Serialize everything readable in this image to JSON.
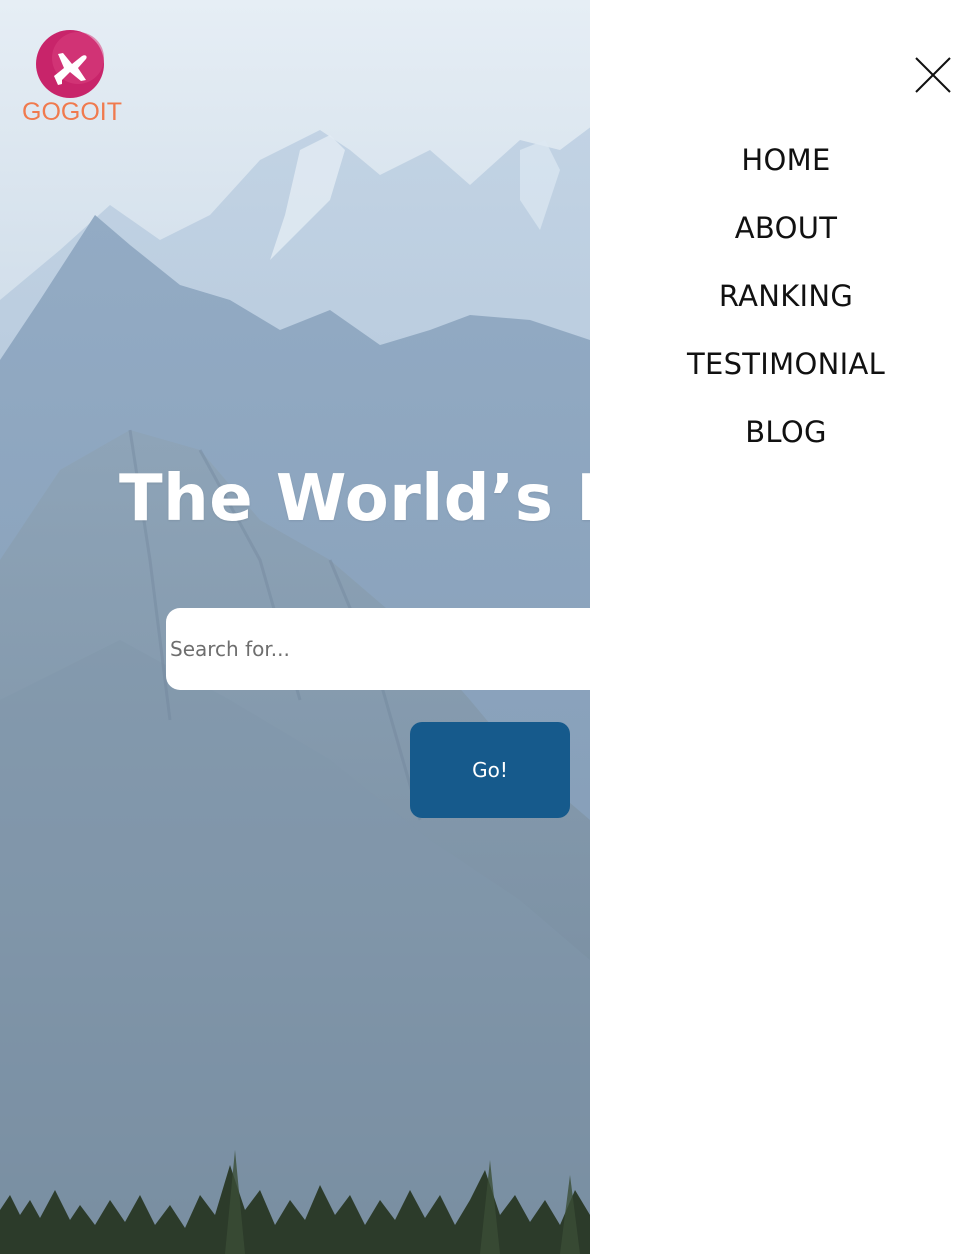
{
  "brand": {
    "name": "GOGOIT",
    "logo_icon": "plane-in-circle-icon",
    "colors": {
      "logo_circle": "#c8246a",
      "logo_text": "#f07a4e"
    }
  },
  "hero": {
    "title": "The World’s Be",
    "search": {
      "placeholder": "Search for...",
      "value": ""
    },
    "go_label": "Go!",
    "colors": {
      "button": "#165a8c",
      "title": "#ffffff"
    }
  },
  "side_nav": {
    "close_icon": "close-icon",
    "items": [
      {
        "label": "HOME"
      },
      {
        "label": "ABOUT"
      },
      {
        "label": "RANKING"
      },
      {
        "label": "TESTIMONIAL"
      },
      {
        "label": "BLOG"
      }
    ]
  }
}
